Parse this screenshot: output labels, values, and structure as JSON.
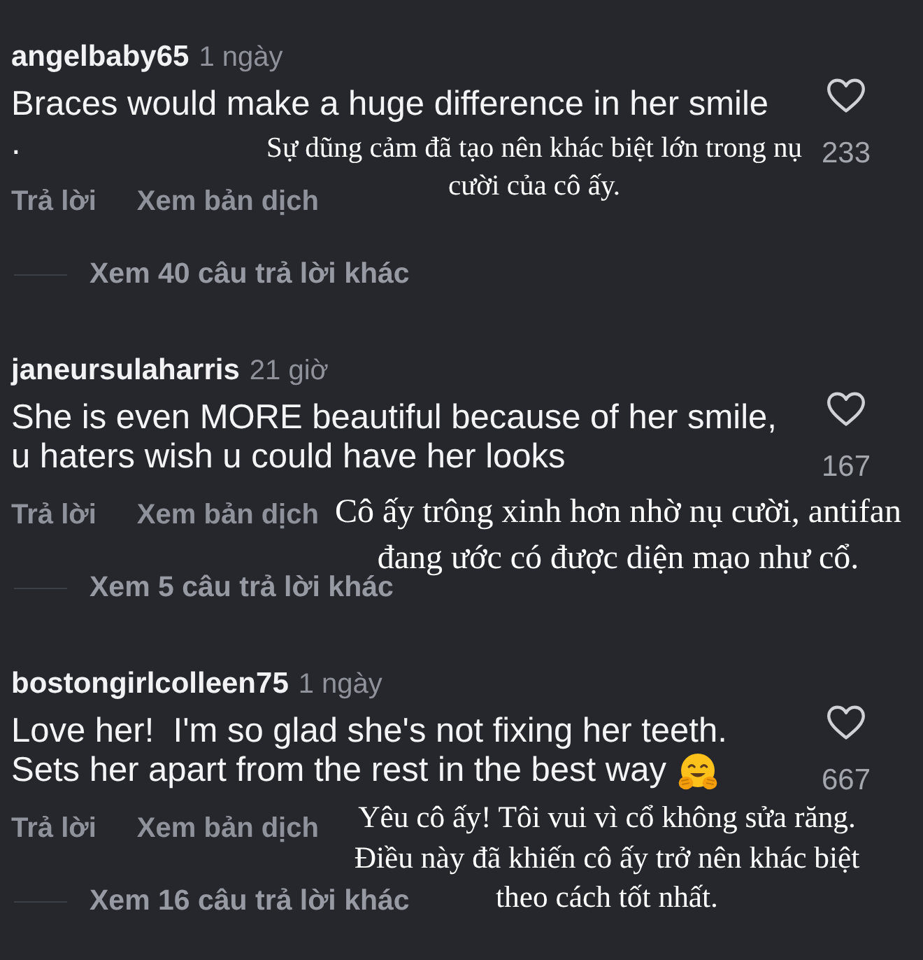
{
  "comments": [
    {
      "username": "angelbaby65",
      "time": "1 ngày",
      "text_lines": [
        "Braces would make a huge difference in her smile",
        "."
      ],
      "trailing_emoji": false,
      "liked": false,
      "like_count": "233",
      "reply_label": "Trả lời",
      "translate_label": "Xem bản dịch",
      "view_replies": "Xem 40 câu trả lời khác",
      "translation_lines": [
        "Sự dũng cảm đã tạo nên khác biệt lớn trong nụ",
        "cười của cô ấy."
      ]
    },
    {
      "username": "janeursulaharris",
      "time": "21 giờ",
      "text_lines": [
        "She is even MORE beautiful because of her smile,",
        "u haters wish u could have her looks"
      ],
      "trailing_emoji": false,
      "liked": false,
      "like_count": "167",
      "reply_label": "Trả lời",
      "translate_label": "Xem bản dịch",
      "view_replies": "Xem 5 câu trả lời khác",
      "translation_lines": [
        "Cô ấy trông xinh hơn nhờ nụ cười, antifan",
        "đang ước có được diện mạo như cổ."
      ]
    },
    {
      "username": "bostongirlcolleen75",
      "time": "1 ngày",
      "text_lines": [
        "Love her!  I'm so glad she's not fixing her teeth.",
        "Sets her apart from the rest in the best way"
      ],
      "trailing_emoji": true,
      "liked": false,
      "like_count": "667",
      "reply_label": "Trả lời",
      "translate_label": "Xem bản dịch",
      "view_replies": "Xem 16 câu trả lời khác",
      "translation_lines": [
        "Yêu cô ấy! Tôi vui vì cổ không sửa răng.",
        "Điều này đã khiến cô ấy trở nên khác biệt",
        "theo cách tốt nhất."
      ]
    }
  ]
}
